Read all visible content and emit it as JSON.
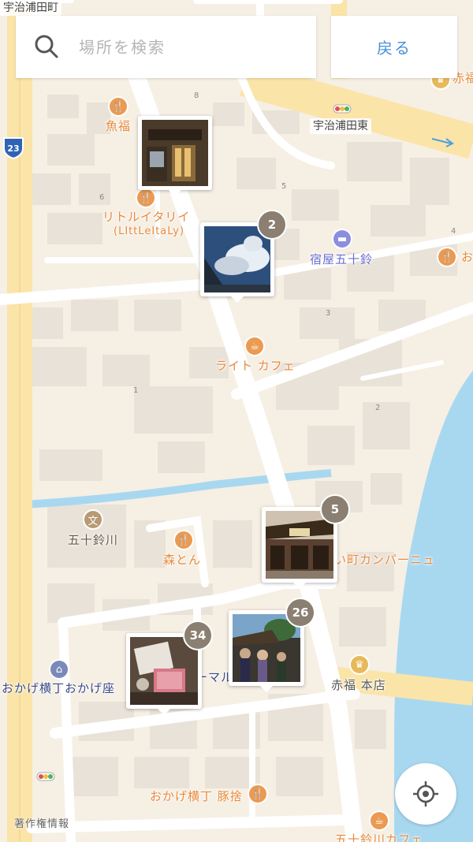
{
  "search": {
    "placeholder": "場所を検索",
    "value": ""
  },
  "back_button": {
    "label": "戻る"
  },
  "copyright": "著作権情報",
  "route_number": "23",
  "roads": {
    "top_left": "宇治浦田町",
    "intersection": "宇治浦田東"
  },
  "places": [
    {
      "name": "魚福",
      "category": "restaurant"
    },
    {
      "name": "リトルイタリイ",
      "category": "restaurant"
    },
    {
      "name": "(LIttLeItaLy)",
      "category": "restaurant-subtitle"
    },
    {
      "name": "宿屋五十鈴",
      "category": "hotel"
    },
    {
      "name": "ライト カフェ",
      "category": "cafe"
    },
    {
      "name": "五十鈴川",
      "category": "school"
    },
    {
      "name": "森とん",
      "category": "restaurant"
    },
    {
      "name": "い町カンパーニュ",
      "category": "shop"
    },
    {
      "name": "おかげ横丁おかげ座",
      "category": "museum"
    },
    {
      "name": "赤福 本店",
      "category": "sweets"
    },
    {
      "name": "おかげ横丁 豚捨",
      "category": "restaurant"
    },
    {
      "name": "ーマル",
      "category": "shop"
    },
    {
      "name": "赤福",
      "category": "sweets"
    },
    {
      "name": "お",
      "category": "restaurant"
    },
    {
      "name": "五十鈴川カフェ",
      "category": "cafe"
    }
  ],
  "block_numbers": [
    "8",
    "6",
    "5",
    "4",
    "3",
    "2",
    "1"
  ],
  "photo_clusters": [
    {
      "count": "",
      "scene": "wooden-storefront"
    },
    {
      "count": "2",
      "scene": "sky-clouds"
    },
    {
      "count": "5",
      "scene": "traditional-shop"
    },
    {
      "count": "26",
      "scene": "crowd-street"
    },
    {
      "count": "34",
      "scene": "food-table"
    }
  ],
  "colors": {
    "map_bg": "#f6efe4",
    "road": "#ffffff",
    "highway": "#fbe4a8",
    "water": "#a8d8f0",
    "accent": "#4a90d9",
    "cluster_badge": "#8b7f72"
  }
}
